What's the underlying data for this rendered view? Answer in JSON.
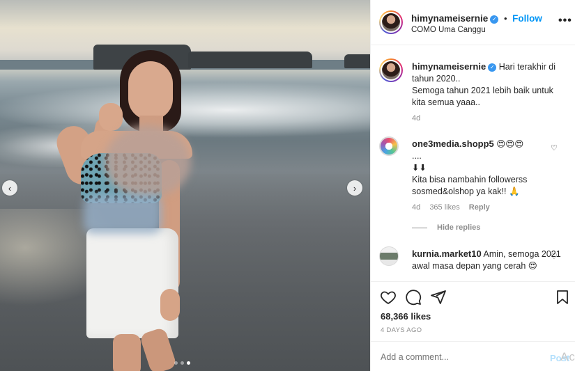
{
  "post": {
    "author": "himynameisernie",
    "follow_label": "Follow",
    "separator": "•",
    "location": "COMO Uma Canggu",
    "more_label": "•••"
  },
  "media": {
    "prev_label": "‹",
    "next_label": "›",
    "slides": 3,
    "active_slide": 3
  },
  "caption": {
    "author": "himynameisernie",
    "text_line1": "Hari terakhir di tahun 2020..",
    "text_line2": "Semoga tahun 2021 lebih baik untuk kita semua yaaa..",
    "age": "4d"
  },
  "comments": [
    {
      "author": "one3media.shopp5",
      "emoji": "😍😍😍",
      "line2": "....",
      "line3": "⬇⬇",
      "text": "Kita bisa nambahin followerss sosmed&olshop ya kak!! 🙏",
      "age": "4d",
      "likes": "365 likes",
      "reply_label": "Reply"
    },
    {
      "author": "kurnia.market10",
      "text": "Amin, semoga 2021 awal masa depan yang cerah 😍"
    }
  ],
  "hide_replies_label": "Hide replies",
  "likes_text": "68,366 likes",
  "date_text": "4 DAYS AGO",
  "comment_placeholder": "Add a comment...",
  "post_button": "Post",
  "watermark_text": "Ac",
  "icons": {
    "like": "heart-outline",
    "comment": "speech-bubble",
    "share": "paper-plane",
    "save": "bookmark"
  },
  "colors": {
    "link_blue": "#0095f6",
    "verified_blue": "#3897f0",
    "muted_text": "#8e8e8e"
  }
}
